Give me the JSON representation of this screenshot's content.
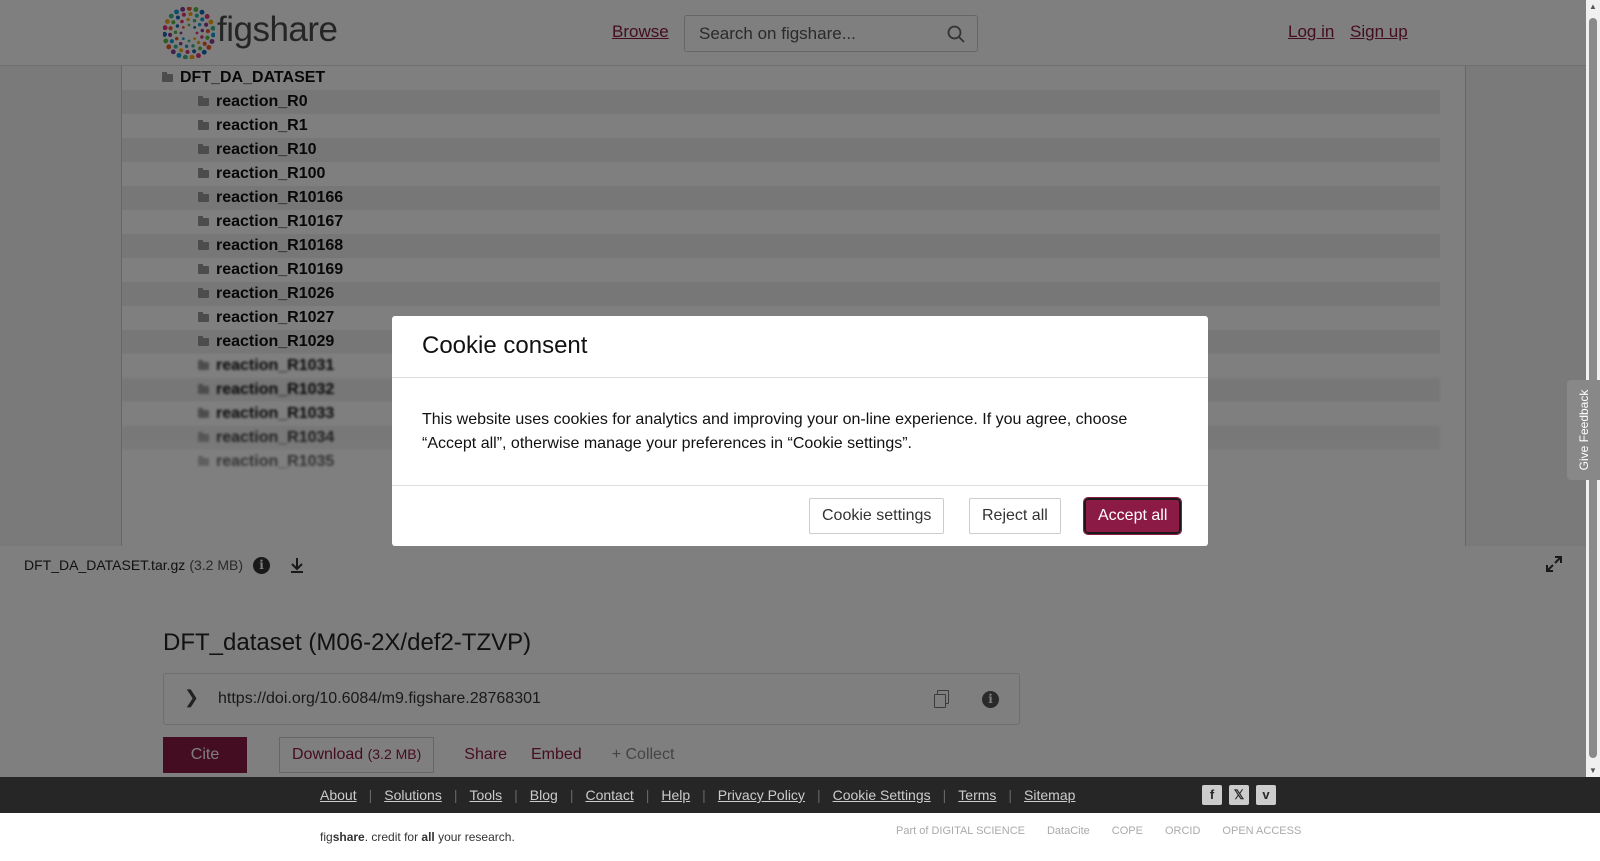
{
  "header": {
    "logo_text": "figshare",
    "browse_label": "Browse",
    "search_placeholder": "Search on figshare...",
    "login_label": "Log in",
    "signup_label": "Sign up"
  },
  "tree": {
    "root": "DFT_DA_DATASET",
    "children": [
      "reaction_R0",
      "reaction_R1",
      "reaction_R10",
      "reaction_R100",
      "reaction_R10166",
      "reaction_R10167",
      "reaction_R10168",
      "reaction_R10169",
      "reaction_R1026",
      "reaction_R1027",
      "reaction_R1029",
      "reaction_R1031",
      "reaction_R1032",
      "reaction_R1033",
      "reaction_R1034",
      "reaction_R1035"
    ]
  },
  "file_bar": {
    "file_name": "DFT_DA_DATASET.tar.gz",
    "file_size": "(3.2 MB)"
  },
  "item": {
    "title": "DFT_dataset (M06-2X/def2-TZVP)",
    "doi": "https://doi.org/10.6084/m9.figshare.28768301",
    "cite_label": "Cite",
    "download_label": "Download",
    "download_size": "(3.2 MB)",
    "share_label": "Share",
    "embed_label": "Embed",
    "collect_label": "+ Collect"
  },
  "feedback_label": "Give Feedback",
  "footer": {
    "links": [
      "About",
      "Solutions",
      "Tools",
      "Blog",
      "Contact",
      "Help",
      "Privacy Policy",
      "Cookie Settings",
      "Terms",
      "Sitemap"
    ],
    "tagline_pre": "fig",
    "tagline_bold1": "share",
    "tagline_mid": ". credit for ",
    "tagline_bold2": "all",
    "tagline_post": " your research.",
    "partners": [
      "Part of DIGITAL SCIENCE",
      "DataCite",
      "COPE",
      "ORCID",
      "OPEN ACCESS"
    ]
  },
  "modal": {
    "title": "Cookie consent",
    "body": "This website uses cookies for analytics and improving your on-line experience. If you agree, choose “Accept all”, otherwise manage your preferences in “Cookie settings”.",
    "cookie_settings_label": "Cookie settings",
    "reject_label": "Reject all",
    "accept_label": "Accept all"
  },
  "colors": {
    "brand": "#8b1a44",
    "footer_bg": "#262626"
  }
}
